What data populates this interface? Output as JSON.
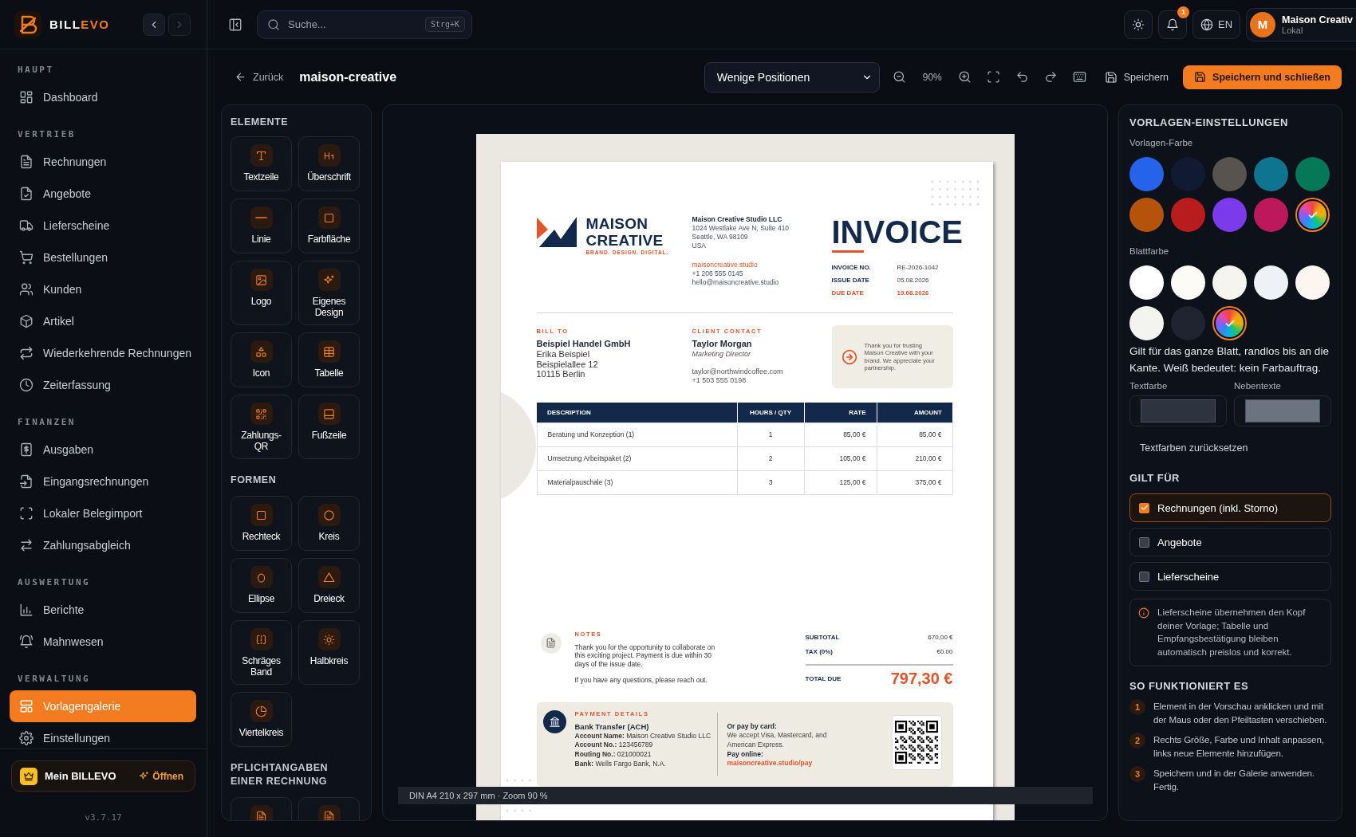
{
  "brand": {
    "first": "BILL",
    "second": "EVO"
  },
  "sidebar": {
    "sections": [
      {
        "title": "HAUPT",
        "items": [
          {
            "label": "Dashboard",
            "selected": false
          }
        ]
      },
      {
        "title": "VERTRIEB",
        "items": [
          {
            "label": "Rechnungen",
            "selected": false
          },
          {
            "label": "Angebote",
            "selected": false
          },
          {
            "label": "Lieferscheine",
            "selected": false
          },
          {
            "label": "Bestellungen",
            "selected": false
          },
          {
            "label": "Kunden",
            "selected": false
          },
          {
            "label": "Artikel",
            "selected": false
          },
          {
            "label": "Wiederkehrende Rechnungen",
            "selected": false
          },
          {
            "label": "Zeiterfassung",
            "selected": false
          }
        ]
      },
      {
        "title": "FINANZEN",
        "items": [
          {
            "label": "Ausgaben",
            "selected": false
          },
          {
            "label": "Eingangsrechnungen",
            "selected": false
          },
          {
            "label": "Lokaler Belegimport",
            "selected": false
          },
          {
            "label": "Zahlungsabgleich",
            "selected": false
          }
        ]
      },
      {
        "title": "AUSWERTUNG",
        "items": [
          {
            "label": "Berichte",
            "selected": false
          },
          {
            "label": "Mahnwesen",
            "selected": false
          }
        ]
      },
      {
        "title": "VERWALTUNG",
        "items": [
          {
            "label": "Vorlagengalerie",
            "selected": true
          },
          {
            "label": "Einstellungen",
            "selected": false
          }
        ]
      }
    ],
    "promo": {
      "title": "Mein BILLEVO",
      "action": "Öffnen"
    },
    "version": "v3.7.17"
  },
  "topbar": {
    "search": {
      "placeholder": "Suche...",
      "shortcut": "Strg+K"
    },
    "notification_count": "1",
    "language": "EN",
    "user": {
      "initial": "M",
      "name": "Maison Creativ",
      "subtitle": "Lokal"
    }
  },
  "editor_toolbar": {
    "back": "Zurück",
    "template_name": "maison-creative",
    "preset": "Wenige Positionen",
    "zoom": "90%",
    "save": "Speichern",
    "save_close": "Speichern und schließen"
  },
  "elements_panel": {
    "groups": [
      {
        "title": "ELEMENTE",
        "items": [
          {
            "kind": "tile",
            "label": "Textzeile"
          },
          {
            "kind": "tile",
            "label": "Überschrift"
          },
          {
            "kind": "tile",
            "label": "Linie"
          },
          {
            "kind": "tile",
            "label": "Farbfläche"
          },
          {
            "kind": "tile",
            "label": "Logo"
          },
          {
            "kind": "tile",
            "label": "Eigenes Design"
          },
          {
            "kind": "tile",
            "label": "Icon"
          },
          {
            "kind": "tile",
            "label": "Tabelle"
          },
          {
            "kind": "tile",
            "label": "Zahlungs-QR"
          },
          {
            "kind": "tile",
            "label": "Fußzeile"
          }
        ]
      },
      {
        "title": "FORMEN",
        "items": [
          {
            "kind": "tile",
            "label": "Rechteck"
          },
          {
            "kind": "tile",
            "label": "Kreis"
          },
          {
            "kind": "tile",
            "label": "Ellipse"
          },
          {
            "kind": "tile",
            "label": "Dreieck"
          },
          {
            "kind": "tile",
            "label": "Schräges Band"
          },
          {
            "kind": "tile",
            "label": "Halbkreis"
          },
          {
            "kind": "tile",
            "label": "Viertelkreis"
          }
        ]
      },
      {
        "title": "PFLICHTANGABEN EINER RECHNUNG",
        "items": [
          {
            "kind": "tile"
          },
          {
            "kind": "tile"
          }
        ]
      }
    ]
  },
  "invoice": {
    "logo": {
      "line1": "MAISON",
      "line2": "CREATIVE",
      "tagline": "BRAND. DESIGN. DIGITAL."
    },
    "sender": {
      "name": "Maison Creative Studio LLC",
      "address": [
        "1024 Westlake Ave N, Suite 410",
        "Seattle, WA 98109",
        "USA"
      ],
      "website": "maisoncreative.studio",
      "phone": "+1 206 555 0145",
      "email": "hello@maisoncreative.studio"
    },
    "title": "INVOICE",
    "meta": [
      {
        "label": "INVOICE NO.",
        "value": "RE-2026-1042",
        "highlight": false
      },
      {
        "label": "ISSUE DATE",
        "value": "05.08.2026",
        "highlight": false
      },
      {
        "label": "DUE DATE",
        "value": "19.08.2026",
        "highlight": true
      }
    ],
    "bill_to": {
      "label": "BILL TO",
      "name": "Beispiel Handel GmbH",
      "lines": [
        "Erika Beispiel",
        "Beispielallee 12",
        "10115 Berlin"
      ]
    },
    "client_contact": {
      "label": "CLIENT CONTACT",
      "name": "Taylor Morgan",
      "role": "Marketing Director",
      "email": "taylor@northwindcoffee.com",
      "phone": "+1 503 555 0198"
    },
    "thanks": "Thank you for trusting Maison Creative with your brand. We appreciate your partnership.",
    "table": {
      "columns": [
        "DESCRIPTION",
        "HOURS / QTY",
        "RATE",
        "AMOUNT"
      ],
      "rows": [
        [
          "Beratung und Konzeption (1)",
          "1",
          "85,00 €",
          "85,00 €"
        ],
        [
          "Umsetzung Arbeitspaket (2)",
          "2",
          "105,00 €",
          "210,00 €"
        ],
        [
          "Materialpauschale (3)",
          "3",
          "125,00 €",
          "375,00 €"
        ]
      ]
    },
    "notes": {
      "label": "NOTES",
      "paragraphs": [
        "Thank you for the opportunity to collaborate on this exciting project. Payment is due within 30 days of the issue date.",
        "If you have any questions, please reach out."
      ]
    },
    "totals": {
      "subtotal_label": "SUBTOTAL",
      "subtotal": "670,00 €",
      "tax_label": "TAX (0%)",
      "tax": "€0.00",
      "total_label": "TOTAL DUE",
      "total": "797,30 €"
    },
    "payment": {
      "label": "PAYMENT DETAILS",
      "bank_title": "Bank Transfer (ACH)",
      "bank_lines": [
        "**Account Name:** Maison Creative Studio LLC",
        "**Account No.:** 123456789",
        "**Routing No.:** 021000021",
        "**Bank:** Wells Fargo Bank, N.A."
      ],
      "card_title": "Or pay by card:",
      "card_text": "We accept Visa, Mastercard, and American Express.",
      "online_label": "Pay online:",
      "online_link": "maisoncreative.studio/pay"
    }
  },
  "status_bar": "DIN A4 210 x 297 mm · Zoom 90 %",
  "settings": {
    "title": "VORLAGEN-EINSTELLUNGEN",
    "template_color": {
      "label": "Vorlagen-Farbe",
      "swatches": [
        {
          "kind": "solid",
          "color": "#2563eb",
          "selected": false
        },
        {
          "kind": "solid",
          "color": "#111a33",
          "selected": false
        },
        {
          "kind": "solid",
          "color": "#57534e",
          "selected": false
        },
        {
          "kind": "solid",
          "color": "#0e7490",
          "selected": false
        },
        {
          "kind": "solid",
          "color": "#047857",
          "selected": false
        },
        {
          "kind": "solid",
          "color": "#b45309",
          "selected": false
        },
        {
          "kind": "solid",
          "color": "#b91c1c",
          "selected": false
        },
        {
          "kind": "solid",
          "color": "#7c3aed",
          "selected": false
        },
        {
          "kind": "solid",
          "color": "#be185d",
          "selected": false
        },
        {
          "kind": "custom",
          "selected": true
        }
      ]
    },
    "sheet_color": {
      "label": "Blattfarbe",
      "swatches": [
        {
          "kind": "solid",
          "color": "#ffffff",
          "selected": false
        },
        {
          "kind": "solid",
          "color": "#fcfbf5",
          "selected": false
        },
        {
          "kind": "solid",
          "color": "#f5f4ef",
          "selected": false
        },
        {
          "kind": "solid",
          "color": "#eef2f7",
          "selected": false
        },
        {
          "kind": "solid",
          "color": "#fdf6f0",
          "selected": false
        },
        {
          "kind": "solid",
          "color": "#f3f4ef",
          "selected": false
        },
        {
          "kind": "solid",
          "color": "#1f2430",
          "selected": false
        },
        {
          "kind": "custom",
          "selected": true
        }
      ],
      "description": "Gilt für das ganze Blatt, randlos bis an die Kante. Weiß bedeutet: kein Farbauftrag."
    },
    "text_colors": [
      {
        "label": "Textfarbe",
        "color": "#2d333f"
      },
      {
        "label": "Nebentexte",
        "color": "#6b7280"
      }
    ],
    "reset": "Textfarben zurücksetzen",
    "applies_to": {
      "title": "GILT FÜR",
      "options": [
        {
          "label": "Rechnungen (inkl. Storno)",
          "checked": true
        },
        {
          "label": "Angebote",
          "checked": false
        },
        {
          "label": "Lieferscheine",
          "checked": false
        }
      ],
      "note": "Lieferscheine übernehmen den Kopf deiner Vorlage; Tabelle und Empfangsbestätigung bleiben automatisch preislos und korrekt."
    },
    "how_it_works": {
      "title": "SO FUNKTIONIERT ES",
      "steps": [
        {
          "number": "1",
          "text": "Element in der Vorschau anklicken und mit der Maus oder den Pfeiltasten verschieben."
        },
        {
          "number": "2",
          "text": "Rechts Größe, Farbe und Inhalt anpassen, links neue Elemente hinzufügen."
        },
        {
          "number": "3",
          "text": "Speichern und in der Galerie anwenden. Fertig."
        }
      ]
    }
  }
}
